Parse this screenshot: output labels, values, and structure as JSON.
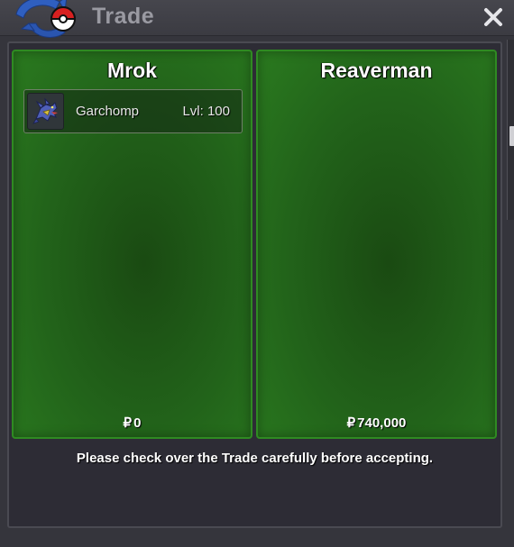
{
  "window": {
    "title": "Trade",
    "close_glyph": "✕",
    "icons": {
      "logo": "pokeball-logo-icon",
      "close": "close-icon"
    }
  },
  "trade": {
    "left": {
      "player_name": "Mrok",
      "pokemon": [
        {
          "name": "Garchomp",
          "level_text": "Lvl: 100",
          "icon": "garchomp-sprite-icon"
        }
      ],
      "currency_symbol": "₽",
      "money": "0"
    },
    "right": {
      "player_name": "Reaverman",
      "pokemon": [],
      "currency_symbol": "₽",
      "money": "740,000"
    }
  },
  "notice": "Please check over the Trade carefully before accepting.",
  "colors": {
    "panel_green": "#22631a",
    "panel_border": "#2f8a22",
    "window_bg": "#35353c",
    "frame_bg": "#2d2c35"
  }
}
